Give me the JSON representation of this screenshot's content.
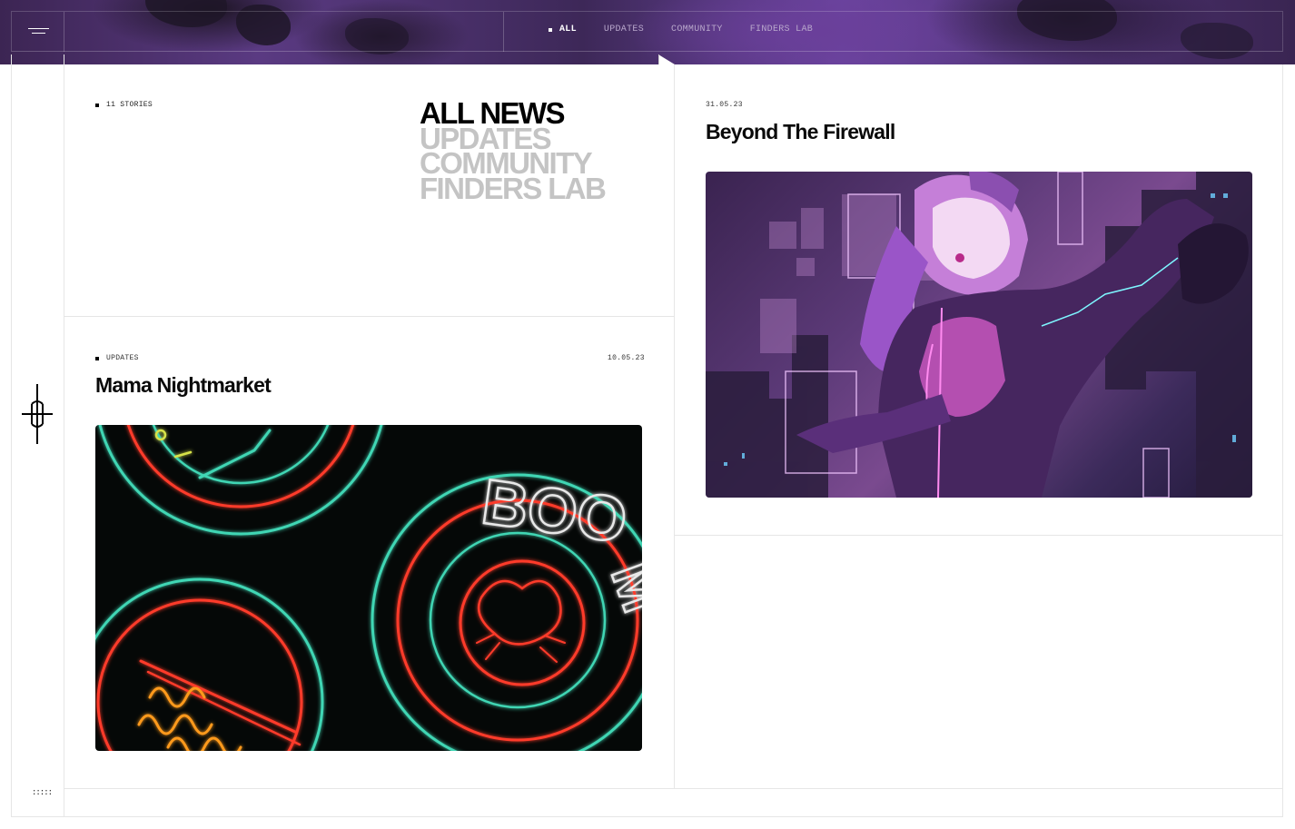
{
  "header": {
    "nav": [
      {
        "label": "ALL",
        "active": true
      },
      {
        "label": "UPDATES",
        "active": false
      },
      {
        "label": "COMMUNITY",
        "active": false
      },
      {
        "label": "FINDERS LAB",
        "active": false
      }
    ]
  },
  "intro": {
    "story_count": "11 STORIES",
    "filters": [
      "ALL NEWS",
      "UPDATES",
      "COMMUNITY",
      "FINDERS LAB"
    ]
  },
  "cards": [
    {
      "category": "UPDATES",
      "date": "10.05.23",
      "title": "Mama Nightmarket"
    },
    {
      "category": "",
      "date": "31.05.23",
      "title": "Beyond The Firewall"
    }
  ],
  "rail": {
    "dots": ":::::"
  },
  "colors": {
    "accent_purple": "#5a3a82",
    "inactive_filter": "#c4c4c4",
    "neon_teal": "#3fd6b4",
    "neon_red": "#ff3b2a",
    "neon_orange": "#ff9a1a"
  }
}
